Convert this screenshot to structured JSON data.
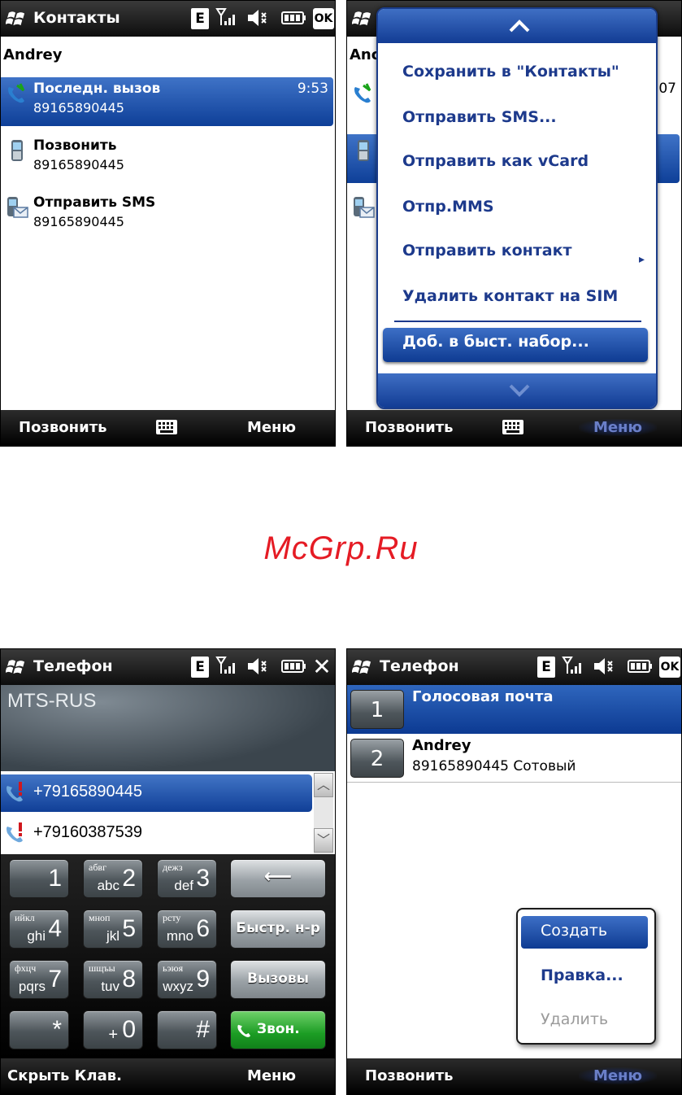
{
  "colors": {
    "accent": "#1d3a8c",
    "selection": "#0e3f98",
    "watermark": "#e51b24",
    "call_green": "#1c9d24"
  },
  "screen1": {
    "title": "Контакты",
    "status": {
      "e": "E",
      "ok": "OK"
    },
    "contact_name": "Andrey",
    "rows": [
      {
        "label": "Последн. вызов",
        "number": "89165890445",
        "time": "9:53",
        "icon": "phone-call-icon"
      },
      {
        "label": "Позвонить",
        "number": "89165890445",
        "icon": "mobile-phone-icon"
      },
      {
        "label": "Отправить SMS",
        "number": "89165890445",
        "icon": "sms-icon"
      }
    ],
    "softkeys": {
      "left": "Позвонить",
      "right": "Меню"
    }
  },
  "screen2": {
    "partial_name": "Anc",
    "partial_time": ":07",
    "menu": [
      "Сохранить в \"Контакты\"",
      "Отправить SMS...",
      "Отправить как vCard",
      "Отпр.MMS",
      "Отправить контакт",
      "Удалить контакт на SIM",
      "Доб. в быст. набор..."
    ],
    "submenu_arrow": "▸",
    "softkeys": {
      "left": "Позвонить",
      "right": "Меню"
    }
  },
  "watermark": "McGrp.Ru",
  "screen3": {
    "title": "Телефон",
    "status": {
      "e": "E",
      "close": "✕"
    },
    "carrier": "MTS-RUS",
    "calls": [
      "+79165890445",
      "+79160387539"
    ],
    "keys": [
      {
        "big": "1",
        "small": "",
        "sub": ""
      },
      {
        "big": "2",
        "small": "абвг",
        "sub": "abc"
      },
      {
        "big": "3",
        "small": "дежз",
        "sub": "def"
      },
      {
        "big": "4",
        "small": "ийкл",
        "sub": "ghi"
      },
      {
        "big": "5",
        "small": "мноп",
        "sub": "jkl"
      },
      {
        "big": "6",
        "small": "рсту",
        "sub": "mno"
      },
      {
        "big": "7",
        "small": "фхцч",
        "sub": "pqrs"
      },
      {
        "big": "8",
        "small": "шщъы",
        "sub": "tuv"
      },
      {
        "big": "9",
        "small": "ьэюя",
        "sub": "wxyz"
      },
      {
        "big": "*",
        "small": "",
        "sub": ""
      },
      {
        "big": "0",
        "small": "",
        "sub": "+"
      },
      {
        "big": "#",
        "small": "",
        "sub": ""
      }
    ],
    "side_keys": {
      "backspace": "⟵",
      "speed": "Быстр. н-р",
      "calls": "Вызовы",
      "talk": "Звон."
    },
    "softkeys": {
      "left": "Скрыть Клав.",
      "right": "Меню"
    }
  },
  "screen4": {
    "title": "Телефон",
    "status": {
      "e": "E",
      "ok": "OK"
    },
    "entries": [
      {
        "num": "1",
        "name": "Голосовая почта",
        "detail": ""
      },
      {
        "num": "2",
        "name": "Andrey",
        "detail": "89165890445 Сотовый"
      }
    ],
    "context_menu": [
      "Создать",
      "Правка...",
      "Удалить"
    ],
    "softkeys": {
      "left": "Позвонить",
      "right": "Меню"
    }
  }
}
